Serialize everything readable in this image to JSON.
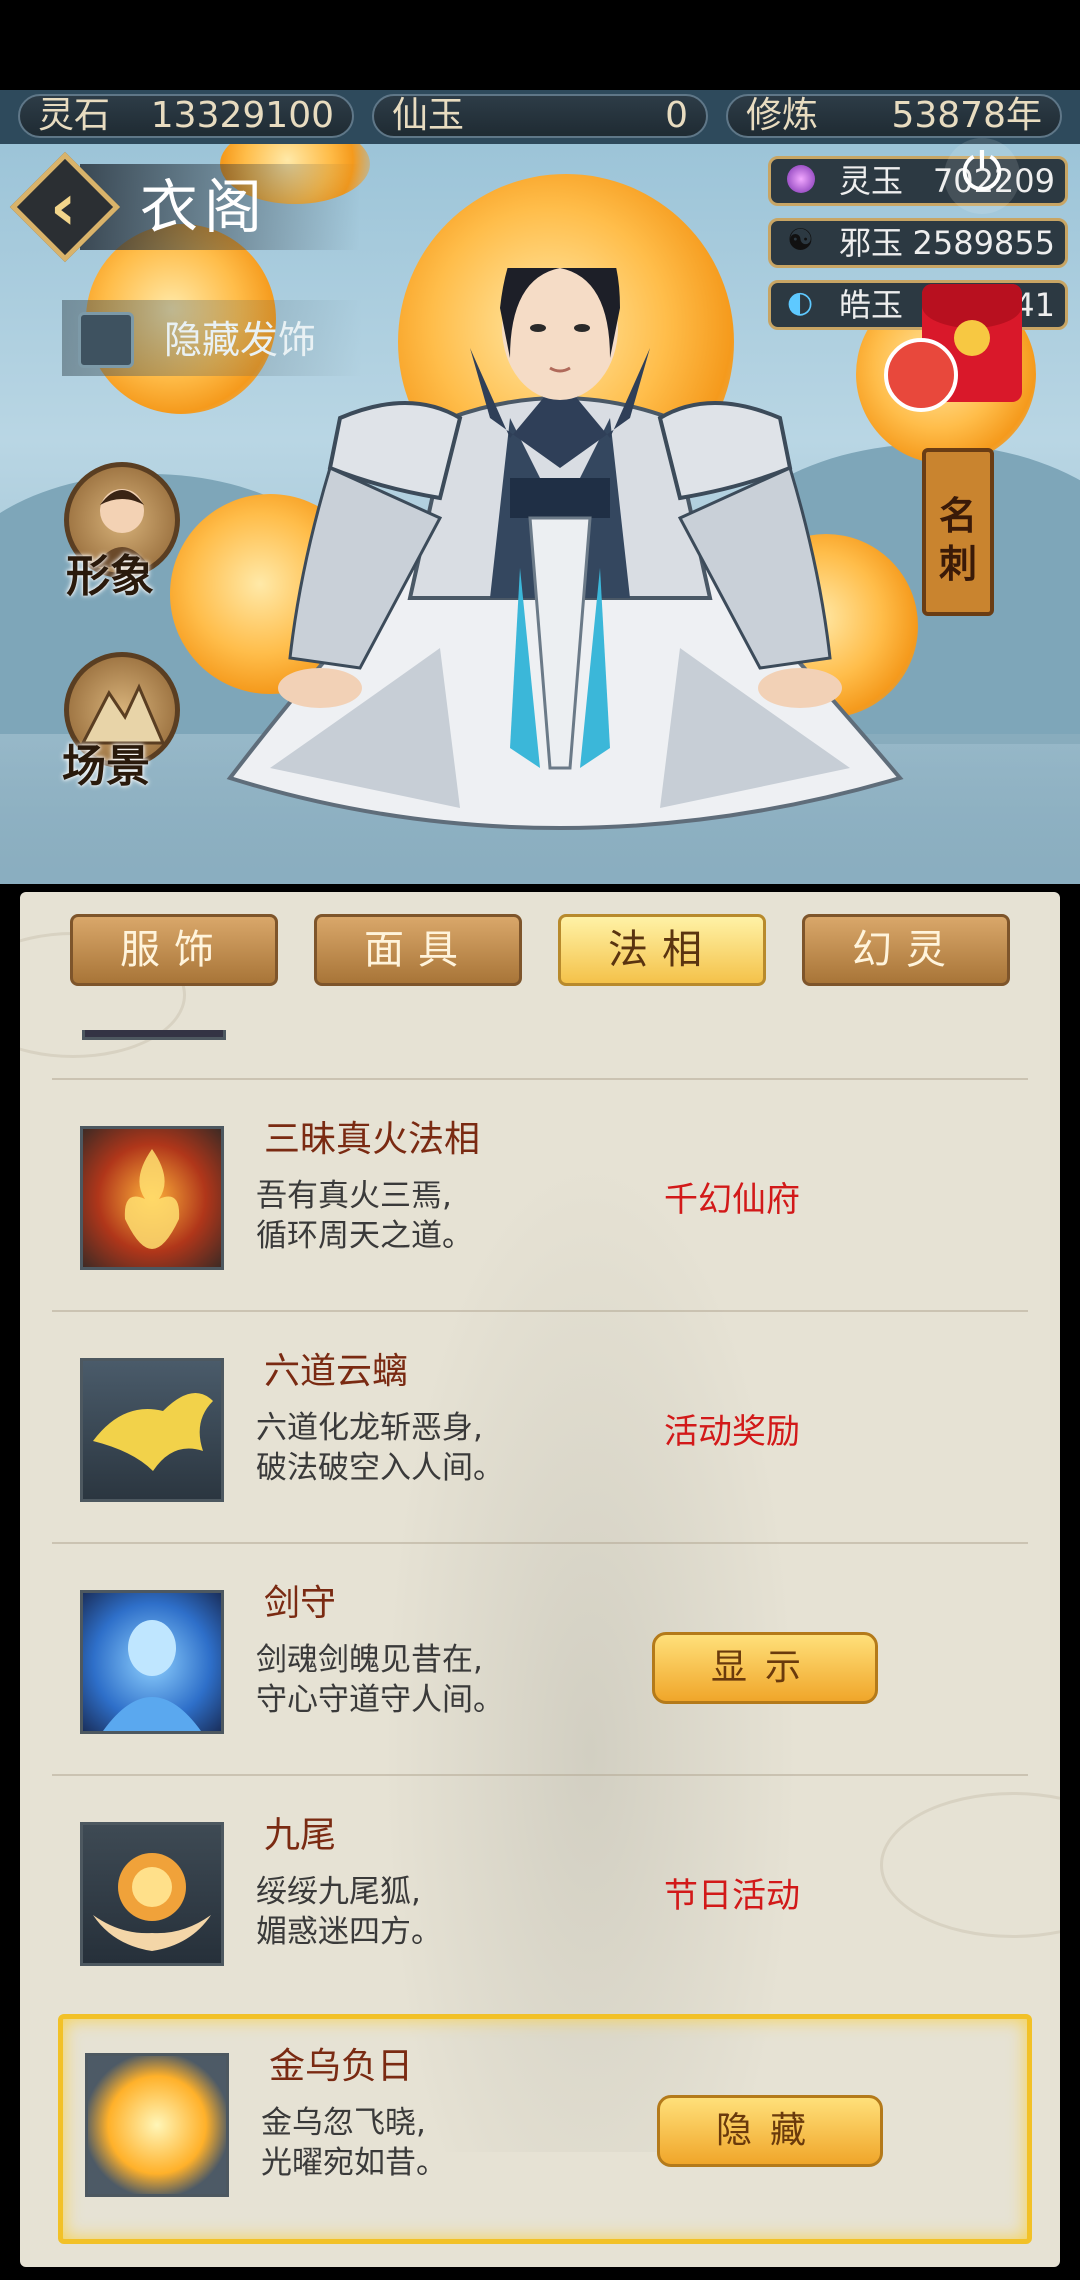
{
  "resources": {
    "lingshi": {
      "label": "灵石",
      "value": "13329100"
    },
    "xianyu": {
      "label": "仙玉",
      "value": "0"
    },
    "xiulian": {
      "label": "修炼",
      "value": "53878年"
    }
  },
  "currencies": [
    {
      "label": "灵玉",
      "value": "702209"
    },
    {
      "label": "邪玉",
      "value": "2589855"
    },
    {
      "label": "皓玉",
      "value": "41"
    }
  ],
  "header": {
    "title": "衣阁"
  },
  "hide_hair": {
    "label": "隐藏发饰"
  },
  "side_buttons": {
    "appearance": "形象",
    "scene": "场景"
  },
  "namecard": {
    "label": "名刺"
  },
  "tabs": [
    {
      "label": "服饰",
      "active": false
    },
    {
      "label": "面具",
      "active": false
    },
    {
      "label": "法相",
      "active": true
    },
    {
      "label": "幻灵",
      "active": false
    }
  ],
  "items": [
    {
      "name": "三昧真火法相",
      "desc1": "吾有真火三焉,",
      "desc2": "循环周天之道。",
      "source": "千幻仙府"
    },
    {
      "name": "六道云螭",
      "desc1": "六道化龙斩恶身,",
      "desc2": "破法破空入人间。",
      "source": "活动奖励"
    },
    {
      "name": "剑守",
      "desc1": "剑魂剑魄见昔在,",
      "desc2": "守心守道守人间。",
      "button": "显示"
    },
    {
      "name": "九尾",
      "desc1": "绥绥九尾狐,",
      "desc2": "媚惑迷四方。",
      "source": "节日活动"
    },
    {
      "name": "金乌负日",
      "desc1": "金乌忽飞晓,",
      "desc2": "光曜宛如昔。",
      "button": "隐藏"
    }
  ],
  "colors": {
    "accent_gold": "#f2c127",
    "source_red": "#d21919",
    "panel_bg": "#e6e2d4"
  }
}
